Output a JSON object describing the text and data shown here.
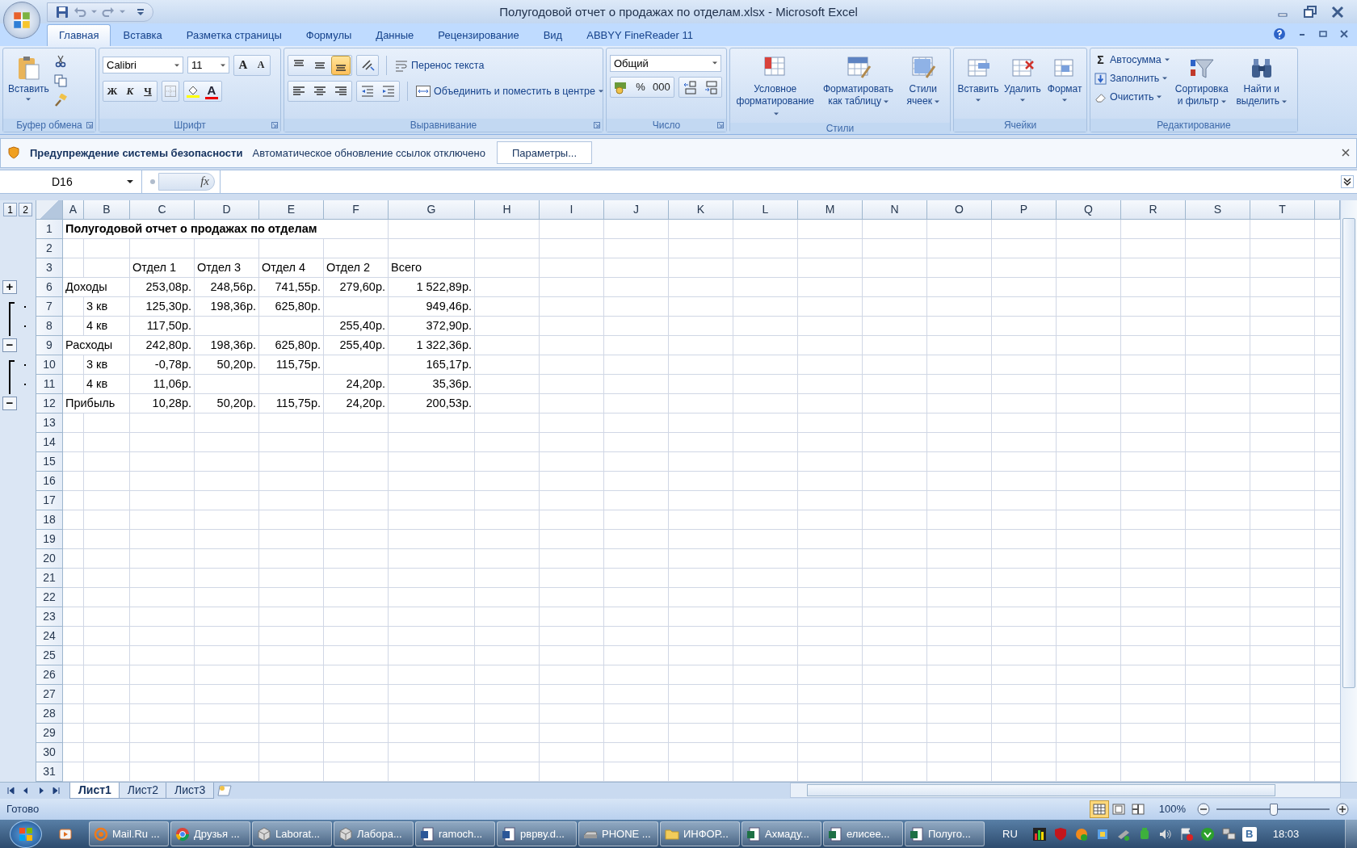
{
  "window": {
    "title": "Полугодовой отчет о продажах по отделам.xlsx - Microsoft Excel"
  },
  "tabs": [
    {
      "label": "Главная",
      "selected": true
    },
    {
      "label": "Вставка",
      "selected": false
    },
    {
      "label": "Разметка страницы",
      "selected": false
    },
    {
      "label": "Формулы",
      "selected": false
    },
    {
      "label": "Данные",
      "selected": false
    },
    {
      "label": "Рецензирование",
      "selected": false
    },
    {
      "label": "Вид",
      "selected": false
    },
    {
      "label": "ABBYY FineReader 11",
      "selected": false
    }
  ],
  "ribbon": {
    "clipboard": {
      "label": "Буфер обмена",
      "paste": "Вставить"
    },
    "font": {
      "label": "Шрифт",
      "family": "Calibri",
      "size": "11",
      "grow": "A",
      "shrink": "A",
      "bold": "Ж",
      "italic": "К",
      "underline": "Ч",
      "font_color": "A"
    },
    "alignment": {
      "label": "Выравнивание",
      "vertical": [
        {
          "selected": false
        },
        {
          "selected": false
        },
        {
          "selected": true
        }
      ],
      "horizontal": [
        {
          "selected": false
        },
        {
          "selected": false
        },
        {
          "selected": false
        }
      ],
      "wrap": "Перенос текста",
      "merge": "Объединить и поместить в центре"
    },
    "number": {
      "label": "Число",
      "format": "Общий",
      "percent": "%",
      "thousands": "000"
    },
    "styles": {
      "label": "Стили",
      "buttons": [
        "Условное форматирование",
        "Форматировать как таблицу",
        "Стили ячеек"
      ]
    },
    "cells": {
      "label": "Ячейки",
      "buttons": [
        "Вставить",
        "Удалить",
        "Формат"
      ]
    },
    "editing": {
      "label": "Редактирование",
      "sigma": "Σ",
      "small": [
        "Автосумма",
        "Заполнить",
        "Очистить"
      ],
      "buttons": [
        "Сортировка и фильтр",
        "Найти и выделить"
      ]
    }
  },
  "security_bar": {
    "title": "Предупреждение системы безопасности",
    "message": "Автоматическое обновление ссылок отключено",
    "button": "Параметры..."
  },
  "formula_bar": {
    "name_box": "D16",
    "fx": "fx"
  },
  "outline_levels": [
    "1",
    "2"
  ],
  "columns": [
    "A",
    "B",
    "C",
    "D",
    "E",
    "F",
    "G",
    "H",
    "I",
    "J",
    "K",
    "L",
    "M",
    "N",
    "O",
    "P",
    "Q",
    "R",
    "S",
    "T"
  ],
  "rows": [
    {
      "number": "1",
      "kind": "title",
      "A": "Полугодовой отчет о продажах по отделам"
    },
    {
      "number": "2",
      "kind": "blank"
    },
    {
      "number": "3",
      "kind": "header",
      "C": "Отдел 1",
      "D": "Отдел 3",
      "E": "Отдел 4",
      "F": "Отдел 2",
      "G": "Всего"
    },
    {
      "number": "6",
      "kind": "data",
      "outline": {
        "kind": "button",
        "symbol": "+"
      },
      "A": "Доходы",
      "C": "253,08р.",
      "D": "248,56р.",
      "E": "741,55р.",
      "F": "279,60р.",
      "G": "1 522,89р."
    },
    {
      "number": "7",
      "kind": "data",
      "outline": {
        "kind": "dot"
      },
      "B": "3 кв",
      "C": "125,30р.",
      "D": "198,36р.",
      "E": "625,80р.",
      "G": "949,46р."
    },
    {
      "number": "8",
      "kind": "data",
      "outline": {
        "kind": "dot"
      },
      "B": "4 кв",
      "C": "117,50р.",
      "F": "255,40р.",
      "G": "372,90р."
    },
    {
      "number": "9",
      "kind": "data",
      "outline": {
        "kind": "button",
        "symbol": "−"
      },
      "A": "Расходы",
      "C": "242,80р.",
      "D": "198,36р.",
      "E": "625,80р.",
      "F": "255,40р.",
      "G": "1 322,36р."
    },
    {
      "number": "10",
      "kind": "data",
      "outline": {
        "kind": "dot"
      },
      "B": "3 кв",
      "C": "-0,78р.",
      "D": "50,20р.",
      "E": "115,75р.",
      "G": "165,17р."
    },
    {
      "number": "11",
      "kind": "data",
      "outline": {
        "kind": "dot"
      },
      "B": "4 кв",
      "C": "11,06р.",
      "F": "24,20р.",
      "G": "35,36р."
    },
    {
      "number": "12",
      "kind": "data",
      "outline": {
        "kind": "button",
        "symbol": "−"
      },
      "A": "Прибыль",
      "C": "10,28р.",
      "D": "50,20р.",
      "E": "115,75р.",
      "F": "24,20р.",
      "G": "200,53р."
    },
    {
      "number": "13",
      "kind": "blank"
    },
    {
      "number": "14",
      "kind": "blank"
    },
    {
      "number": "15",
      "kind": "blank"
    },
    {
      "number": "16",
      "kind": "blank"
    },
    {
      "number": "17",
      "kind": "blank"
    },
    {
      "number": "18",
      "kind": "blank"
    },
    {
      "number": "19",
      "kind": "blank"
    },
    {
      "number": "20",
      "kind": "blank"
    },
    {
      "number": "21",
      "kind": "blank"
    },
    {
      "number": "22",
      "kind": "blank"
    },
    {
      "number": "23",
      "kind": "blank"
    },
    {
      "number": "24",
      "kind": "blank"
    },
    {
      "number": "25",
      "kind": "blank"
    },
    {
      "number": "26",
      "kind": "blank"
    },
    {
      "number": "27",
      "kind": "blank"
    },
    {
      "number": "28",
      "kind": "blank"
    },
    {
      "number": "29",
      "kind": "blank"
    },
    {
      "number": "30",
      "kind": "blank"
    },
    {
      "number": "31",
      "kind": "blank"
    }
  ],
  "sheets": [
    {
      "label": "Лист1",
      "selected": true
    },
    {
      "label": "Лист2",
      "selected": false
    },
    {
      "label": "Лист3",
      "selected": false
    }
  ],
  "status": {
    "text": "Готово",
    "views": [
      {
        "selected": true
      },
      {
        "selected": false
      },
      {
        "selected": false
      }
    ],
    "zoom": "100%",
    "zoom_slider": {
      "level": 0.5
    }
  },
  "taskbar": {
    "items": [
      {
        "label": "Mail.Ru ...",
        "kind": "mail"
      },
      {
        "label": "Друзья ...",
        "kind": "browser"
      },
      {
        "label": "Laborat...",
        "kind": "cube"
      },
      {
        "label": "Лабора...",
        "kind": "cube"
      },
      {
        "label": "ramoch...",
        "kind": "document"
      },
      {
        "label": "рврву.d...",
        "kind": "document"
      },
      {
        "label": "PHONE ...",
        "kind": "drive"
      },
      {
        "label": "ИНФОР...",
        "kind": "folder"
      },
      {
        "label": "Ахмаду...",
        "kind": "sheet"
      },
      {
        "label": "елисее...",
        "kind": "sheet"
      },
      {
        "label": "Полуго...",
        "kind": "sheet"
      }
    ],
    "language": "RU",
    "tray_letter": "В",
    "clock": "18:03"
  }
}
